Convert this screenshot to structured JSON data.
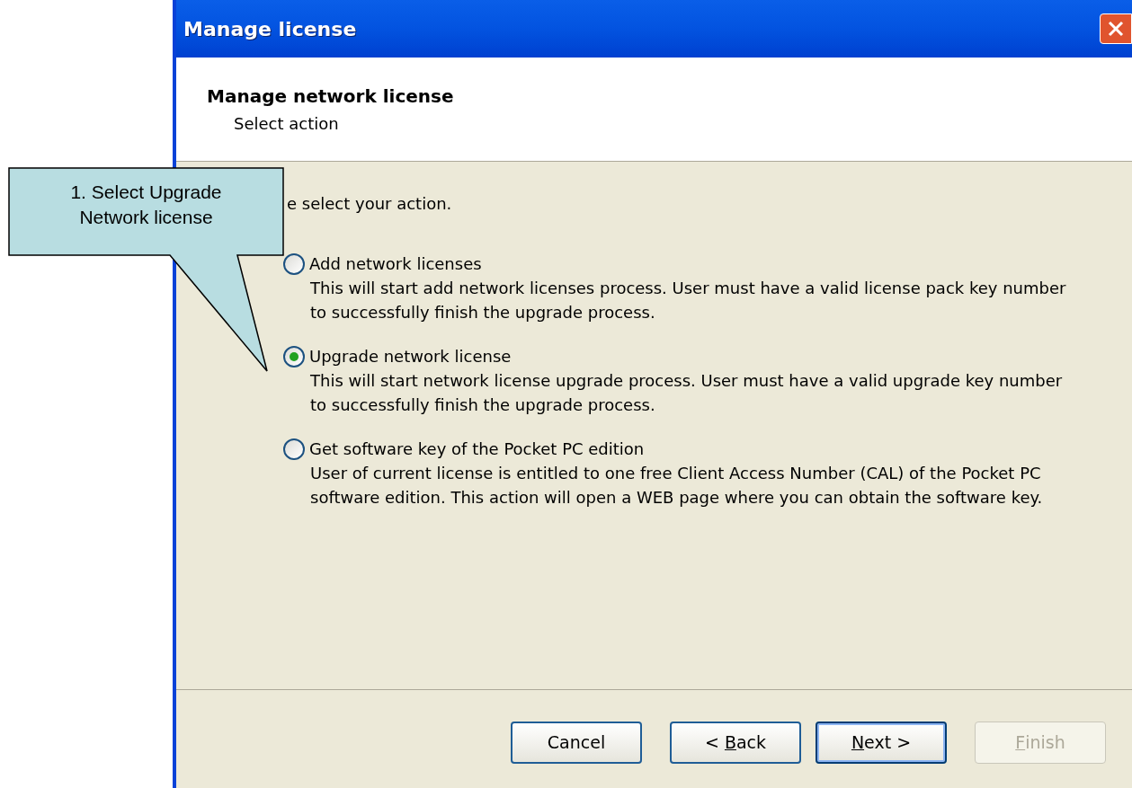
{
  "window": {
    "title": "Manage license"
  },
  "header": {
    "title": "Manage network license",
    "subtitle": "Select action"
  },
  "intro": "e select your action.",
  "options": [
    {
      "label": "Add network licenses",
      "selected": false,
      "description": "This will start add network licenses process. User must have a valid license pack key number to successfully finish the upgrade process."
    },
    {
      "label": "Upgrade network license",
      "selected": true,
      "description": "This will start network license upgrade process. User must have a valid upgrade key number to successfully finish the upgrade process."
    },
    {
      "label": "Get software key of the Pocket PC edition",
      "selected": false,
      "description": "User of current license is entitled to one free Client Access Number (CAL) of the Pocket PC software edition. This action will open a WEB page where you can obtain the software key."
    }
  ],
  "buttons": [
    {
      "before": "Cancel",
      "default": false,
      "disabled": false
    },
    {
      "before": "< ",
      "key": "B",
      "after": "ack",
      "default": false,
      "disabled": false
    },
    {
      "key": "N",
      "after": "ext >",
      "default": true,
      "disabled": false
    },
    {
      "key": "F",
      "after": "inish",
      "default": false,
      "disabled": true
    }
  ],
  "callout": {
    "text": "1. Select Upgrade Network license"
  }
}
